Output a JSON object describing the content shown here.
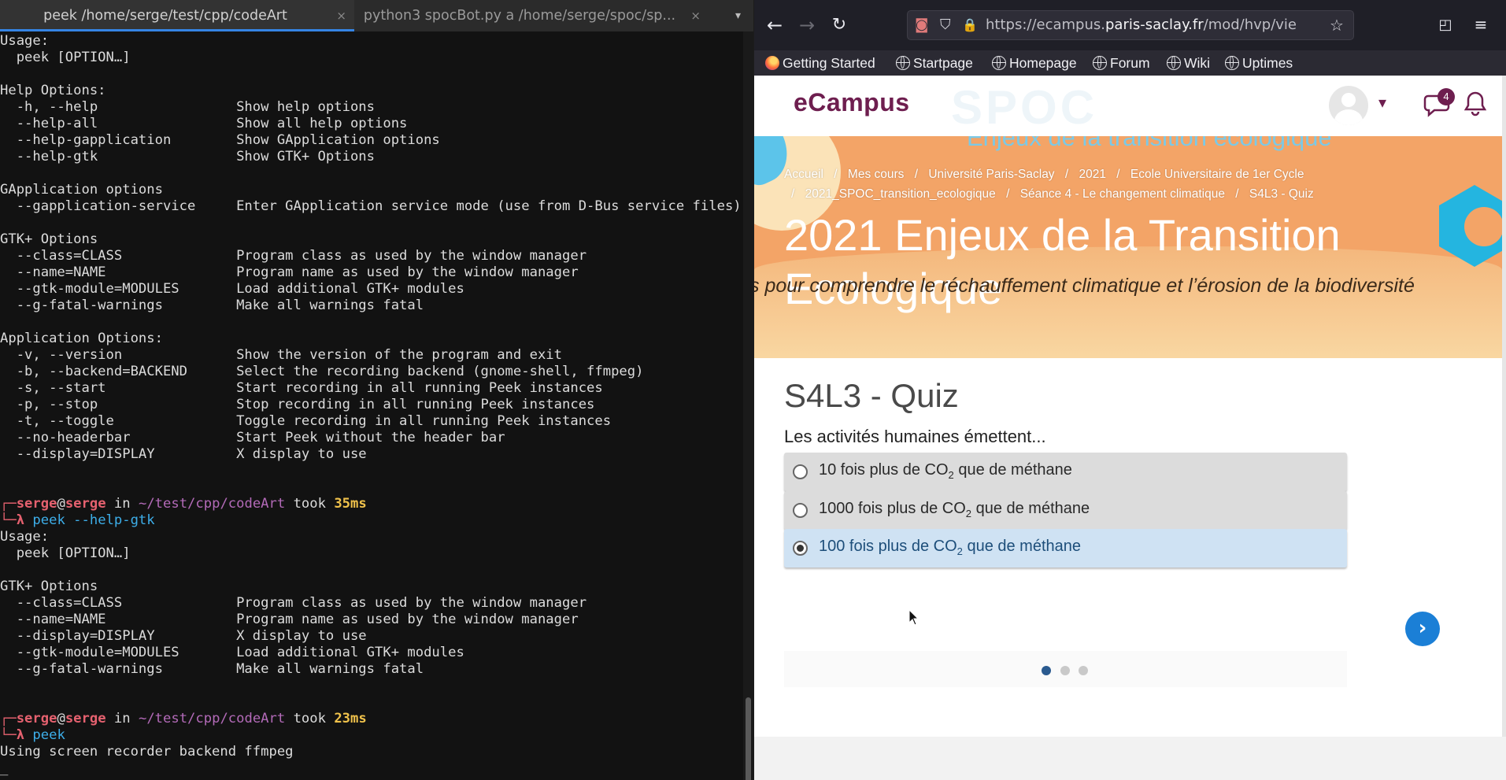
{
  "terminal": {
    "tabs": [
      {
        "label": "peek /home/serge/test/cpp/codeArt",
        "close": "×"
      },
      {
        "label": "python3 spocBot.py a /home/serge/spoc/sp...",
        "close": "×"
      }
    ],
    "tab_menu": "▾",
    "lines": [
      {
        "t": "Usage:"
      },
      {
        "t": "  peek [OPTION…]"
      },
      {
        "t": ""
      },
      {
        "t": "Help Options:"
      },
      {
        "t": "  -h, --help                 Show help options"
      },
      {
        "t": "  --help-all                 Show all help options"
      },
      {
        "t": "  --help-gapplication        Show GApplication options"
      },
      {
        "t": "  --help-gtk                 Show GTK+ Options"
      },
      {
        "t": ""
      },
      {
        "t": "GApplication options"
      },
      {
        "t": "  --gapplication-service     Enter GApplication service mode (use from D-Bus service files)"
      },
      {
        "t": ""
      },
      {
        "t": "GTK+ Options"
      },
      {
        "t": "  --class=CLASS              Program class as used by the window manager"
      },
      {
        "t": "  --name=NAME                Program name as used by the window manager"
      },
      {
        "t": "  --gtk-module=MODULES       Load additional GTK+ modules"
      },
      {
        "t": "  --g-fatal-warnings         Make all warnings fatal"
      },
      {
        "t": ""
      },
      {
        "t": "Application Options:"
      },
      {
        "t": "  -v, --version              Show the version of the program and exit"
      },
      {
        "t": "  -b, --backend=BACKEND      Select the recording backend (gnome-shell, ffmpeg)"
      },
      {
        "t": "  -s, --start                Start recording in all running Peek instances"
      },
      {
        "t": "  -p, --stop                 Stop recording in all running Peek instances"
      },
      {
        "t": "  -t, --toggle               Toggle recording in all running Peek instances"
      },
      {
        "t": "  --no-headerbar             Start Peek without the header bar"
      },
      {
        "t": "  --display=DISPLAY          X display to use"
      },
      {
        "t": ""
      },
      {
        "t": ""
      },
      {
        "prompt": true,
        "corner": "┌─",
        "user": "serge",
        "at": "@",
        "host": "serge",
        "in": " in ",
        "path": "~/test/cpp/codeArt",
        "took": " took ",
        "time": "35ms"
      },
      {
        "cmd": true,
        "corner": "└─λ ",
        "command": "peek --help-gtk"
      },
      {
        "t": "Usage:"
      },
      {
        "t": "  peek [OPTION…]"
      },
      {
        "t": ""
      },
      {
        "t": "GTK+ Options"
      },
      {
        "t": "  --class=CLASS              Program class as used by the window manager"
      },
      {
        "t": "  --name=NAME                Program name as used by the window manager"
      },
      {
        "t": "  --display=DISPLAY          X display to use"
      },
      {
        "t": "  --gtk-module=MODULES       Load additional GTK+ modules"
      },
      {
        "t": "  --g-fatal-warnings         Make all warnings fatal"
      },
      {
        "t": ""
      },
      {
        "t": ""
      },
      {
        "prompt": true,
        "corner": "┌─",
        "user": "serge",
        "at": "@",
        "host": "serge",
        "in": " in ",
        "path": "~/test/cpp/codeArt",
        "took": " took ",
        "time": "23ms"
      },
      {
        "cmd": true,
        "corner": "└─λ ",
        "command": "peek"
      },
      {
        "t": "Using screen recorder backend ffmpeg"
      },
      {
        "t": "_"
      }
    ]
  },
  "browser": {
    "url_prefix": "https://ecampus.",
    "url_domain": "paris-saclay.fr",
    "url_path": "/mod/hvp/view.php?i",
    "bookmarks": [
      "Getting Started",
      "Startpage",
      "Homepage",
      "Forum",
      "Wiki",
      "Uptimes"
    ],
    "icons": {
      "back": "←",
      "forward": "→",
      "reload": "↻",
      "tracker": "◙",
      "shield": "⛉",
      "lock": "🔒",
      "star": "☆",
      "pocket": "◰",
      "menu": "≡"
    }
  },
  "site": {
    "brand": "eCampus",
    "banner_faded_text": "Enjeux de la transition écologique",
    "banner_faded_logo": "SPOC",
    "notification_count": "4",
    "user_caret": "▾",
    "breadcrumbs": [
      "Accueil",
      "Mes cours",
      "Université Paris-Saclay",
      "2021",
      "Ecole Universitaire de 1er Cycle",
      "2021_SPOC_transition_ecologique",
      "Séance 4 - Le changement climatique",
      "S4L3 - Quiz"
    ],
    "breadcrumb_sep": "/",
    "course_title": "2021 Enjeux de la Transition Ecologique",
    "subtitle": "s pour comprendre le réchauffement climatique et l’érosion de la biodiversité",
    "quiz": {
      "title": "S4L3 - Quiz",
      "question": "Les activités humaines émettent...",
      "options": [
        {
          "before": "10 fois plus de CO",
          "sub": "2",
          "after": " que de méthane",
          "selected": false
        },
        {
          "before": "1000 fois plus de CO",
          "sub": "2",
          "after": " que de méthane",
          "selected": false
        },
        {
          "before": "100 fois plus de CO",
          "sub": "2",
          "after": " que de méthane",
          "selected": true
        }
      ],
      "next_icon": "›",
      "pages_total": 3,
      "page_current": 1
    },
    "colors": {
      "brand": "#6e1e4f",
      "banner": "#f3a467",
      "accent_blue": "#1b7fd6",
      "selected_option": "#cfe2f3"
    }
  }
}
